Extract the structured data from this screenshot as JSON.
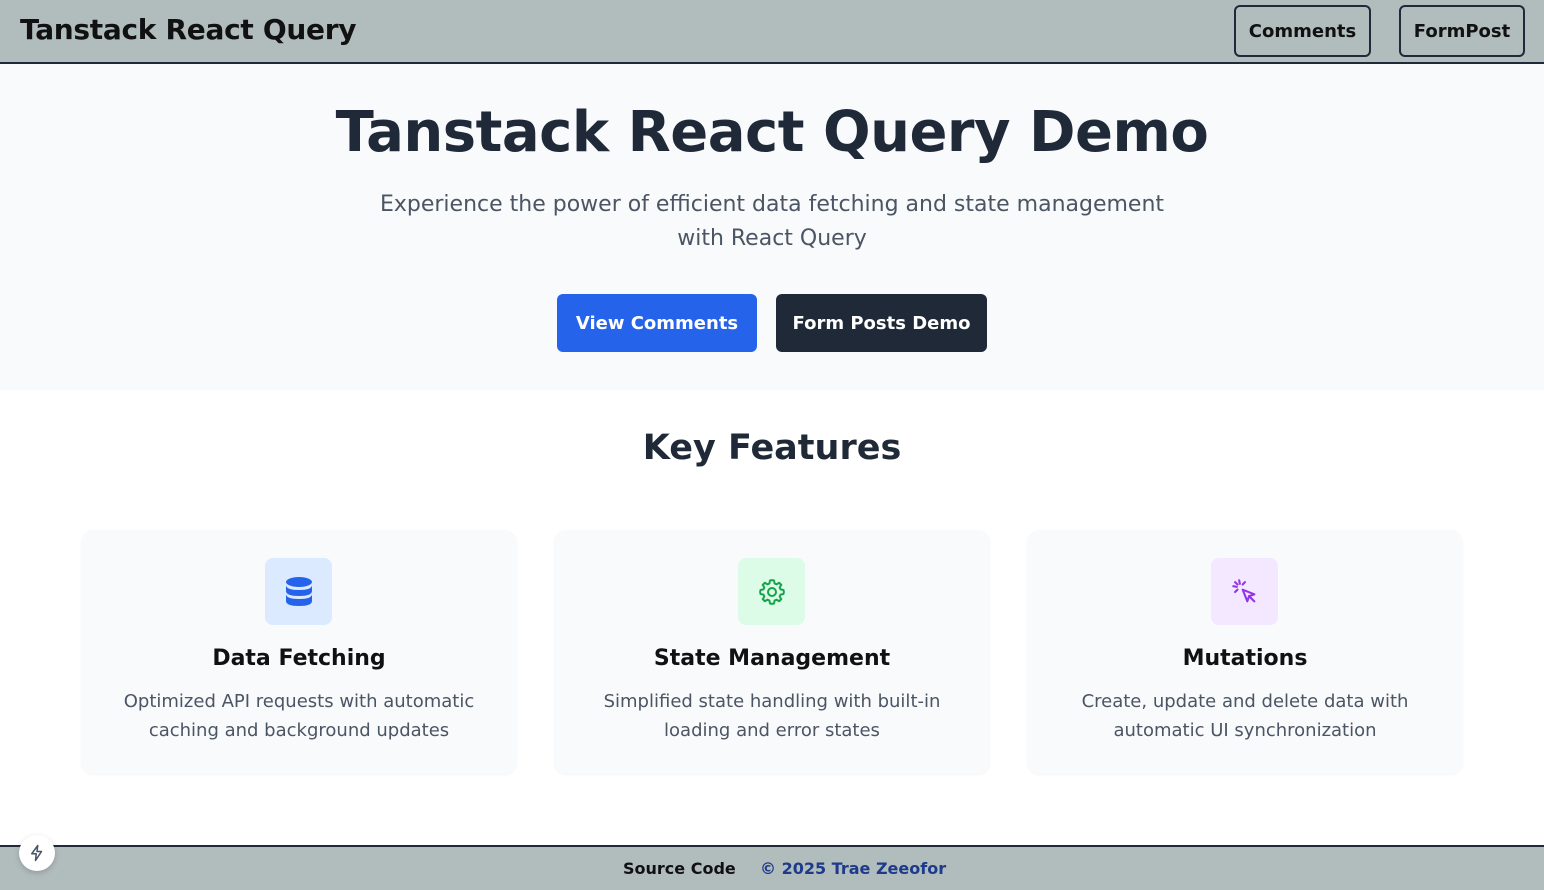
{
  "header": {
    "brand": "Tanstack React Query",
    "nav": {
      "comments": "Comments",
      "formpost": "FormPost"
    }
  },
  "hero": {
    "title": "Tanstack React Query Demo",
    "subtitle": "Experience the power of efficient data fetching and state management with React Query",
    "buttons": {
      "comments": "View Comments",
      "forms": "Form Posts Demo"
    }
  },
  "features": {
    "title": "Key Features",
    "items": [
      {
        "icon": "database-icon",
        "icon_color": "#2563eb",
        "icon_bg": "#dbeafe",
        "title": "Data Fetching",
        "description": "Optimized API requests with automatic caching and background updates"
      },
      {
        "icon": "gear-icon",
        "icon_color": "#16a34a",
        "icon_bg": "#dcfce7",
        "title": "State Management",
        "description": "Simplified state handling with built-in loading and error states"
      },
      {
        "icon": "cursor-click-icon",
        "icon_color": "#9333ea",
        "icon_bg": "#f3e8ff",
        "title": "Mutations",
        "description": "Create, update and delete data with automatic UI synchronization"
      }
    ]
  },
  "footer": {
    "source": "Source Code",
    "copyright": "© 2025 Trae Zeeofor"
  },
  "colors": {
    "header_bg": "#b1bcbc",
    "hero_bg": "#f8fafc",
    "primary": "#2563eb",
    "dark": "#1f2937",
    "footer_link": "#1e3a8a"
  }
}
